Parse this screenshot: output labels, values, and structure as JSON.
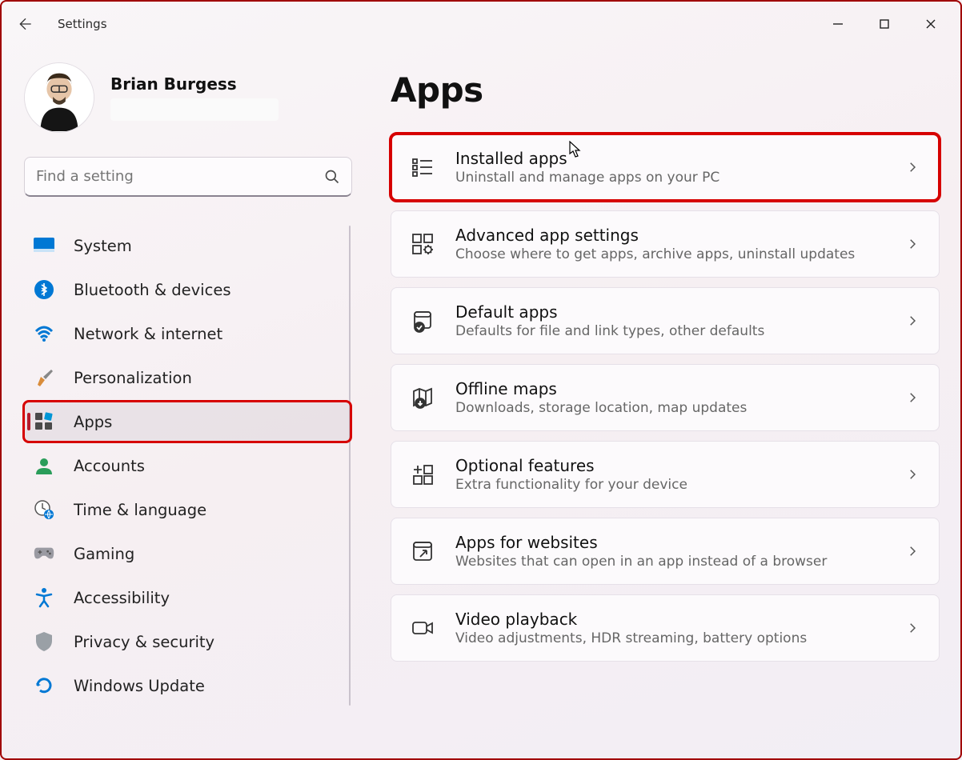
{
  "app": {
    "title": "Settings"
  },
  "profile": {
    "name": "Brian Burgess"
  },
  "search": {
    "placeholder": "Find a setting"
  },
  "sidebar": {
    "items": [
      {
        "label": "System"
      },
      {
        "label": "Bluetooth & devices"
      },
      {
        "label": "Network & internet"
      },
      {
        "label": "Personalization"
      },
      {
        "label": "Apps",
        "selected": true
      },
      {
        "label": "Accounts"
      },
      {
        "label": "Time & language"
      },
      {
        "label": "Gaming"
      },
      {
        "label": "Accessibility"
      },
      {
        "label": "Privacy & security"
      },
      {
        "label": "Windows Update"
      }
    ]
  },
  "page": {
    "title": "Apps"
  },
  "cards": [
    {
      "title": "Installed apps",
      "sub": "Uninstall and manage apps on your PC",
      "highlight": true
    },
    {
      "title": "Advanced app settings",
      "sub": "Choose where to get apps, archive apps, uninstall updates"
    },
    {
      "title": "Default apps",
      "sub": "Defaults for file and link types, other defaults"
    },
    {
      "title": "Offline maps",
      "sub": "Downloads, storage location, map updates"
    },
    {
      "title": "Optional features",
      "sub": "Extra functionality for your device"
    },
    {
      "title": "Apps for websites",
      "sub": "Websites that can open in an app instead of a browser"
    },
    {
      "title": "Video playback",
      "sub": "Video adjustments, HDR streaming, battery options"
    }
  ]
}
